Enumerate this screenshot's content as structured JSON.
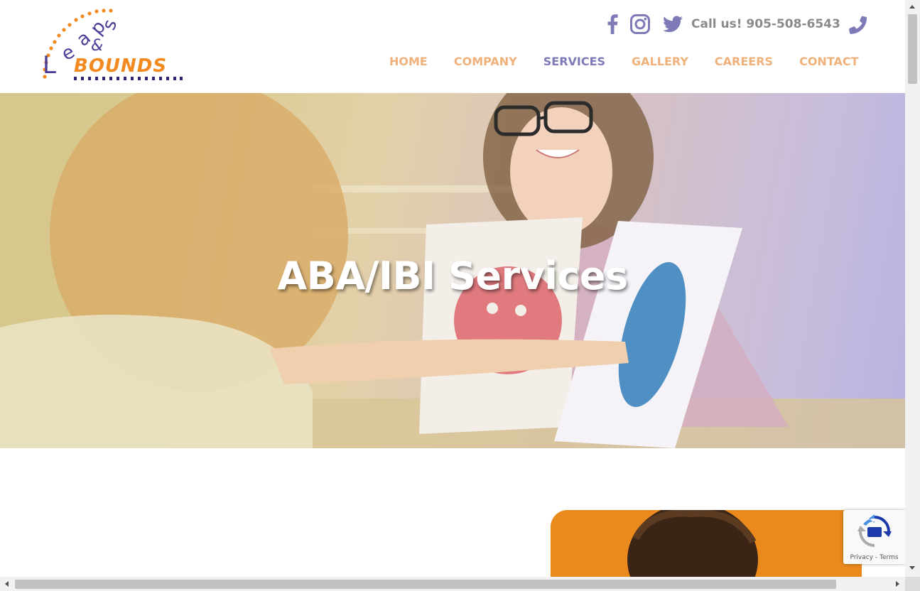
{
  "brand": {
    "logo_top_word": "Leaps",
    "logo_amp": "&",
    "logo_bottom_word": "BOUNDS",
    "colors": {
      "orange": "#f28a1f",
      "purple": "#4b3c98",
      "nav_orange": "#f0b07a",
      "nav_active": "#7e7ab8",
      "icon_purple": "#7e7ab8"
    }
  },
  "header": {
    "social": [
      {
        "name": "facebook-icon"
      },
      {
        "name": "instagram-icon"
      },
      {
        "name": "twitter-icon"
      }
    ],
    "call_text": "Call us! 905-508-6543",
    "phone_icon": "phone-icon"
  },
  "nav": {
    "items": [
      {
        "label": "HOME",
        "active": false
      },
      {
        "label": "COMPANY",
        "active": false
      },
      {
        "label": "SERVICES",
        "active": true
      },
      {
        "label": "GALLERY",
        "active": false
      },
      {
        "label": "CAREERS",
        "active": false
      },
      {
        "label": "CONTACT",
        "active": false
      }
    ]
  },
  "hero": {
    "title": "ABA/IBI Services"
  },
  "recaptcha": {
    "privacy": "Privacy",
    "separator": " - ",
    "terms": "Terms"
  }
}
